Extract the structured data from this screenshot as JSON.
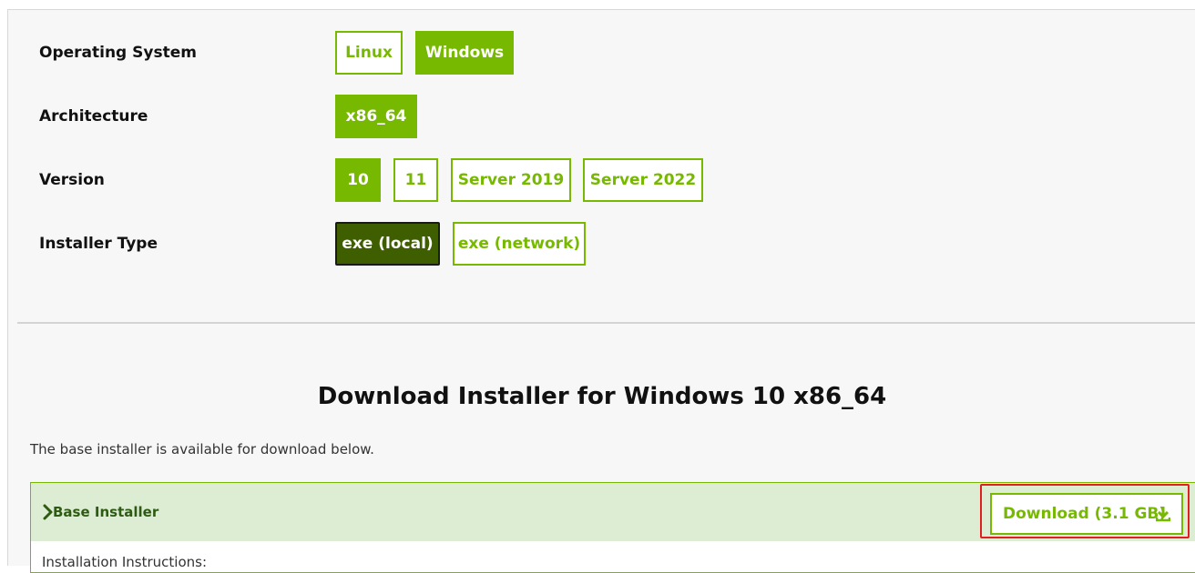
{
  "options": {
    "os": {
      "label": "Operating System",
      "choices": [
        "Linux",
        "Windows"
      ]
    },
    "arch": {
      "label": "Architecture",
      "choices": [
        "x86_64"
      ]
    },
    "version": {
      "label": "Version",
      "choices": [
        "10",
        "11",
        "Server 2019",
        "Server 2022"
      ]
    },
    "installer_type": {
      "label": "Installer Type",
      "choices": [
        "exe (local)",
        "exe (network)"
      ]
    }
  },
  "selected": {
    "os": "Windows",
    "arch": "x86_64",
    "version": "10",
    "installer_type": "exe (local)"
  },
  "download": {
    "heading": "Download Installer for Windows 10 x86_64",
    "description": "The base installer is available for download below.",
    "installer_title": "Base Installer",
    "button_label": "Download (3.1 GB)",
    "instructions_label": "Installation Instructions:"
  },
  "colors": {
    "accent": "#76b900",
    "accent_dark": "#3f5e00",
    "header_bg": "#dcedd3",
    "highlight": "#e02020"
  },
  "icons": {
    "chevron": "chevron-right-icon",
    "download": "download-icon"
  }
}
